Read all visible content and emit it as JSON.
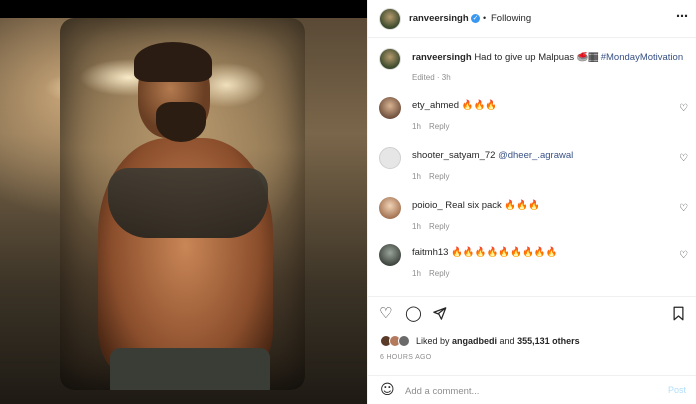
{
  "post": {
    "author": "ranveersingh",
    "follow_separator": "•",
    "follow_status": "Following",
    "more_icon": "more-horizontal-icon",
    "caption_user": "ranveersingh",
    "caption_text": "Had to give up Malpuas 🥌🏾 ",
    "caption_hashtag": "#MondayMotivation",
    "caption_meta": "Edited · 3h"
  },
  "comments": [
    {
      "user": "ety_ahmed",
      "text": "🔥🔥🔥",
      "time": "1h",
      "reply": "Reply"
    },
    {
      "user": "shooter_satyam_72",
      "mention": "@dheer_.agrawal",
      "time": "1h",
      "reply": "Reply"
    },
    {
      "user": "poioio_",
      "text": "Real six pack 🔥🔥🔥",
      "time": "1h",
      "reply": "Reply"
    },
    {
      "user": "faitmh13",
      "text": "🔥🔥🔥🔥🔥🔥🔥🔥🔥",
      "time": "1h",
      "reply": "Reply"
    }
  ],
  "actions": {
    "like_icon": "heart-icon",
    "comment_icon": "comment-icon",
    "share_icon": "share-icon",
    "save_icon": "bookmark-icon"
  },
  "likes": {
    "prefix": "Liked by ",
    "user": "angadbedi",
    "middle": " and ",
    "count": "355,131 others"
  },
  "timestamp": "6 HOURS AGO",
  "add_comment": {
    "placeholder": "Add a comment...",
    "post_label": "Post"
  },
  "colors": {
    "accent": "#3897f0",
    "link": "#385185",
    "muted": "#8e8e8e",
    "post_disabled": "#b2dffc"
  }
}
